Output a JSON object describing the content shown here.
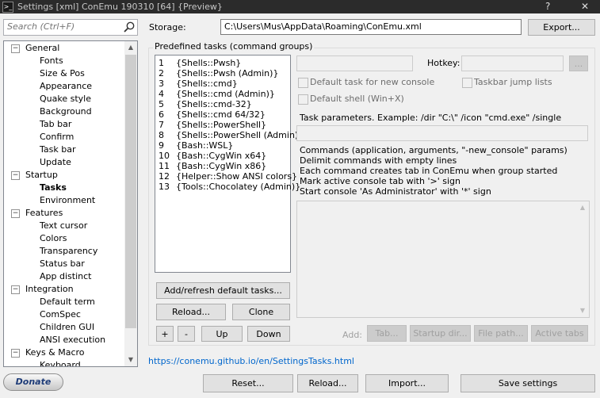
{
  "window": {
    "title": "Settings [xml] ConEmu 190310 [64] {Preview}",
    "help_label": "?",
    "close_label": "✕",
    "app_icon": "conemu-icon"
  },
  "search": {
    "placeholder": "Search (Ctrl+F)"
  },
  "tree": {
    "items": [
      {
        "label": "General",
        "expanded": "−"
      },
      {
        "label": "Fonts"
      },
      {
        "label": "Size & Pos"
      },
      {
        "label": "Appearance"
      },
      {
        "label": "Quake style"
      },
      {
        "label": "Background"
      },
      {
        "label": "Tab bar"
      },
      {
        "label": "Confirm"
      },
      {
        "label": "Task bar"
      },
      {
        "label": "Update"
      },
      {
        "label": "Startup",
        "expanded": "−"
      },
      {
        "label": "Tasks",
        "selected": true
      },
      {
        "label": "Environment"
      },
      {
        "label": "Features",
        "expanded": "−"
      },
      {
        "label": "Text cursor"
      },
      {
        "label": "Colors"
      },
      {
        "label": "Transparency"
      },
      {
        "label": "Status bar"
      },
      {
        "label": "App distinct"
      },
      {
        "label": "Integration",
        "expanded": "−"
      },
      {
        "label": "Default term"
      },
      {
        "label": "ComSpec"
      },
      {
        "label": "Children GUI"
      },
      {
        "label": "ANSI execution"
      },
      {
        "label": "Keys & Macro",
        "expanded": "−"
      },
      {
        "label": "Keyboard"
      }
    ]
  },
  "storage": {
    "label": "Storage:",
    "path": "C:\\Users\\Mus\\AppData\\Roaming\\ConEmu.xml",
    "export_label": "Export..."
  },
  "tasks": {
    "group_title": "Predefined tasks (command groups)",
    "list": [
      {
        "num": "1",
        "name": "{Shells::Pwsh}"
      },
      {
        "num": "2",
        "name": "{Shells::Pwsh (Admin)}"
      },
      {
        "num": "3",
        "name": "{Shells::cmd}"
      },
      {
        "num": "4",
        "name": "{Shells::cmd (Admin)}"
      },
      {
        "num": "5",
        "name": "{Shells::cmd-32}"
      },
      {
        "num": "6",
        "name": "{Shells::cmd 64/32}"
      },
      {
        "num": "7",
        "name": "{Shells::PowerShell}"
      },
      {
        "num": "8",
        "name": "{Shells::PowerShell (Admin)}"
      },
      {
        "num": "9",
        "name": "{Bash::WSL}"
      },
      {
        "num": "10",
        "name": "{Bash::CygWin x64}"
      },
      {
        "num": "11",
        "name": "{Bash::CygWin x86}"
      },
      {
        "num": "12",
        "name": "{Helper::Show ANSI colors}"
      },
      {
        "num": "13",
        "name": "{Tools::Chocolatey (Admin)}"
      }
    ],
    "add_refresh_label": "Add/refresh default tasks...",
    "reload_label": "Reload...",
    "clone_label": "Clone",
    "plus_label": "+",
    "minus_label": "-",
    "up_label": "Up",
    "down_label": "Down"
  },
  "details": {
    "hotkey_label": "Hotkey:",
    "hotkey_browse_label": "...",
    "default_task_label": "Default task for new console",
    "taskbar_jump_label": "Taskbar jump lists",
    "default_shell_label": "Default shell (Win+X)",
    "task_params_label": "Task parameters. Example: /dir \"C:\\\" /icon \"cmd.exe\" /single",
    "commands_help": [
      "Commands (application, arguments, \"-new_console\" params)",
      "Delimit commands with empty lines",
      "Each command creates tab in ConEmu when group started",
      "Mark active console tab with '>' sign",
      "Start console 'As Administrator' with '*' sign"
    ],
    "add_label": "Add:",
    "tab_btn": "Tab...",
    "startup_dir_btn": "Startup dir...",
    "file_path_btn": "File path...",
    "active_tabs_btn": "Active tabs"
  },
  "footer": {
    "link": "https://conemu.github.io/en/SettingsTasks.html",
    "donate_label": "Donate",
    "reset_label": "Reset...",
    "reload_label": "Reload...",
    "import_label": "Import...",
    "save_label": "Save settings"
  }
}
